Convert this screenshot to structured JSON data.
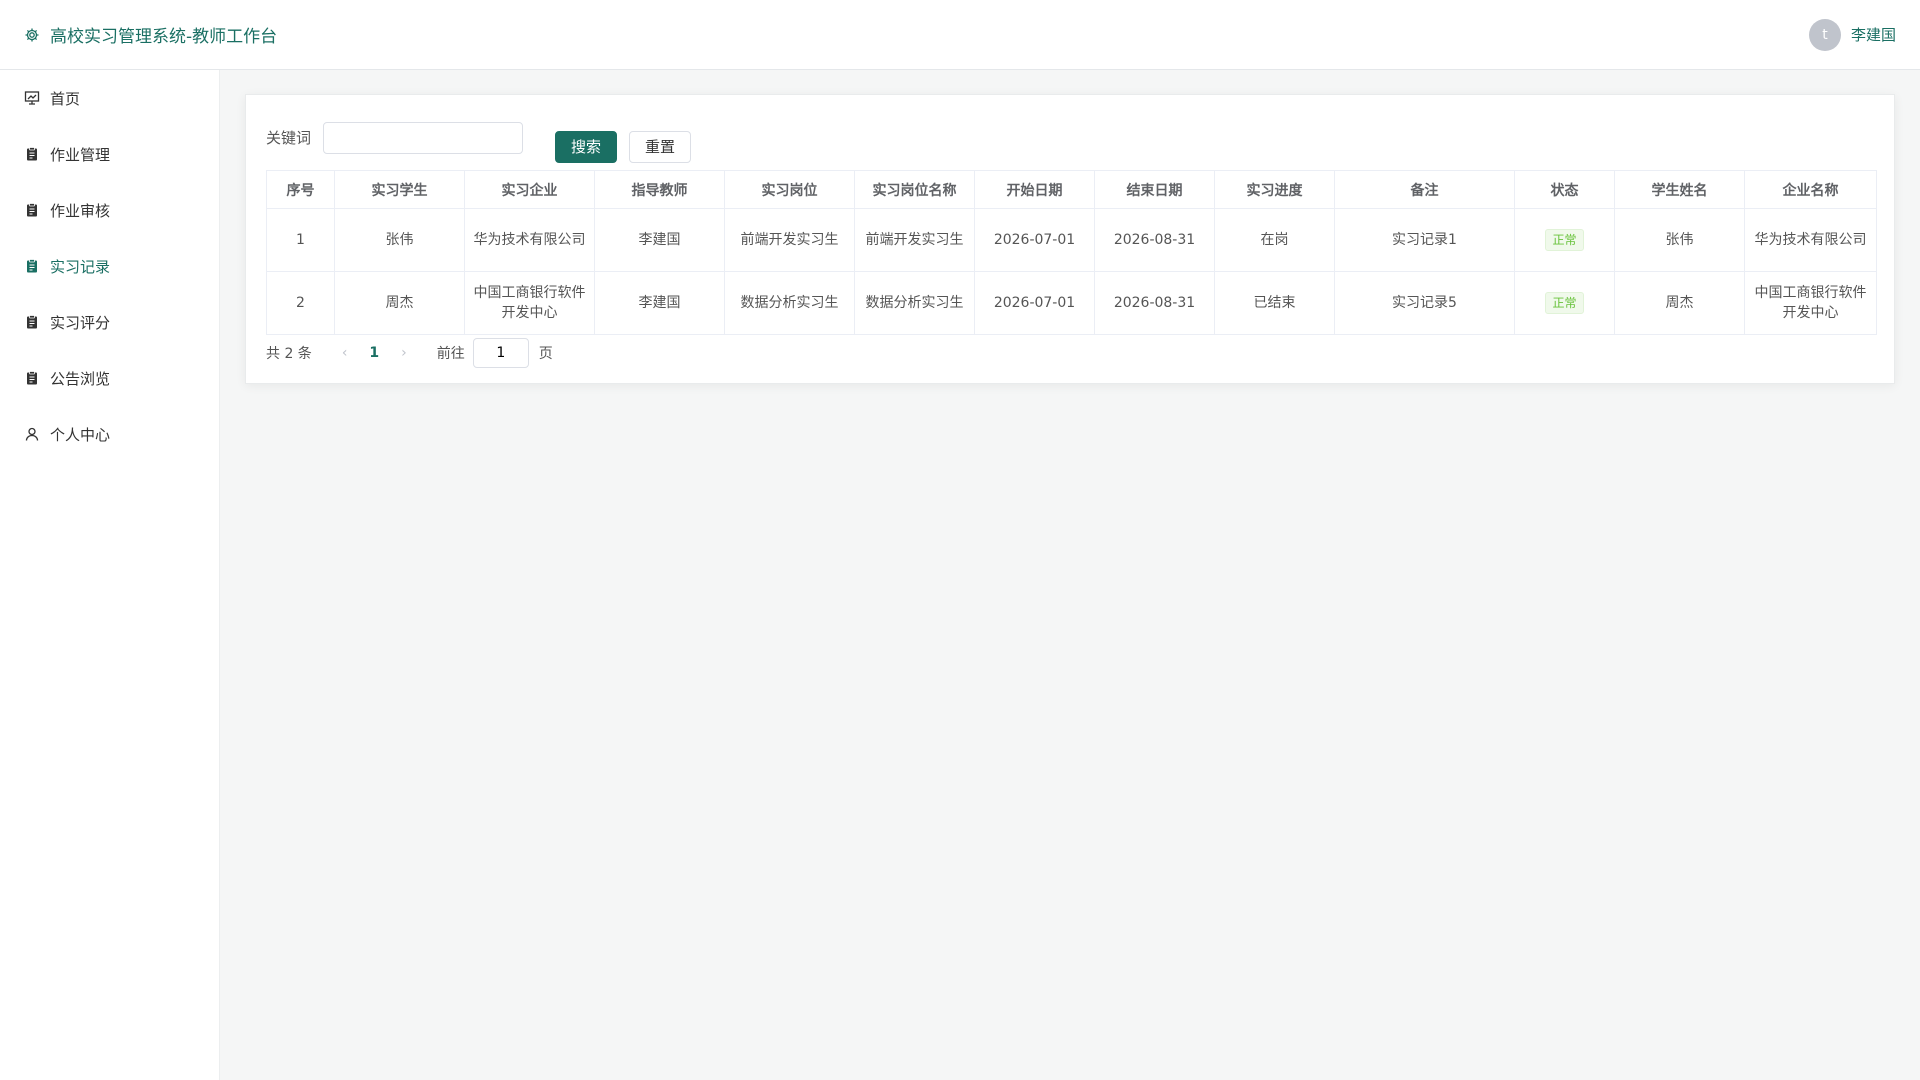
{
  "header": {
    "title": "高校实习管理系统-教师工作台",
    "user_initial": "t",
    "user_name": "李建国"
  },
  "sidebar": {
    "items": [
      {
        "label": "首页",
        "icon": "dashboard-icon"
      },
      {
        "label": "作业管理",
        "icon": "clipboard-icon"
      },
      {
        "label": "作业审核",
        "icon": "clipboard-icon"
      },
      {
        "label": "实习记录",
        "icon": "clipboard-icon",
        "active": true
      },
      {
        "label": "实习评分",
        "icon": "clipboard-icon"
      },
      {
        "label": "公告浏览",
        "icon": "clipboard-icon"
      },
      {
        "label": "个人中心",
        "icon": "user-icon"
      }
    ]
  },
  "search": {
    "label": "关键词",
    "value": "",
    "placeholder": "",
    "search_label": "搜索",
    "reset_label": "重置"
  },
  "table": {
    "columns": [
      "序号",
      "实习学生",
      "实习企业",
      "指导教师",
      "实习岗位",
      "实习岗位名称",
      "开始日期",
      "结束日期",
      "实习进度",
      "备注",
      "状态",
      "学生姓名",
      "企业名称"
    ],
    "rows": [
      [
        "1",
        "张伟",
        "华为技术有限公司",
        "李建国",
        "前端开发实习生",
        "前端开发实习生",
        "2026-07-01",
        "2026-08-31",
        "在岗",
        "实习记录1",
        "正常",
        "张伟",
        "华为技术有限公司"
      ],
      [
        "2",
        "周杰",
        "中国工商银行软件开发中心",
        "李建国",
        "数据分析实习生",
        "数据分析实习生",
        "2026-07-01",
        "2026-08-31",
        "已结束",
        "实习记录5",
        "正常",
        "周杰",
        "中国工商银行软件开发中心"
      ]
    ]
  },
  "pagination": {
    "total_label": "共 2 条",
    "current_page": "1",
    "goto_label": "前往",
    "goto_value": "1",
    "page_suffix": "页"
  },
  "colors": {
    "accent": "#1a6f63",
    "tag_green": "#67c23a"
  }
}
